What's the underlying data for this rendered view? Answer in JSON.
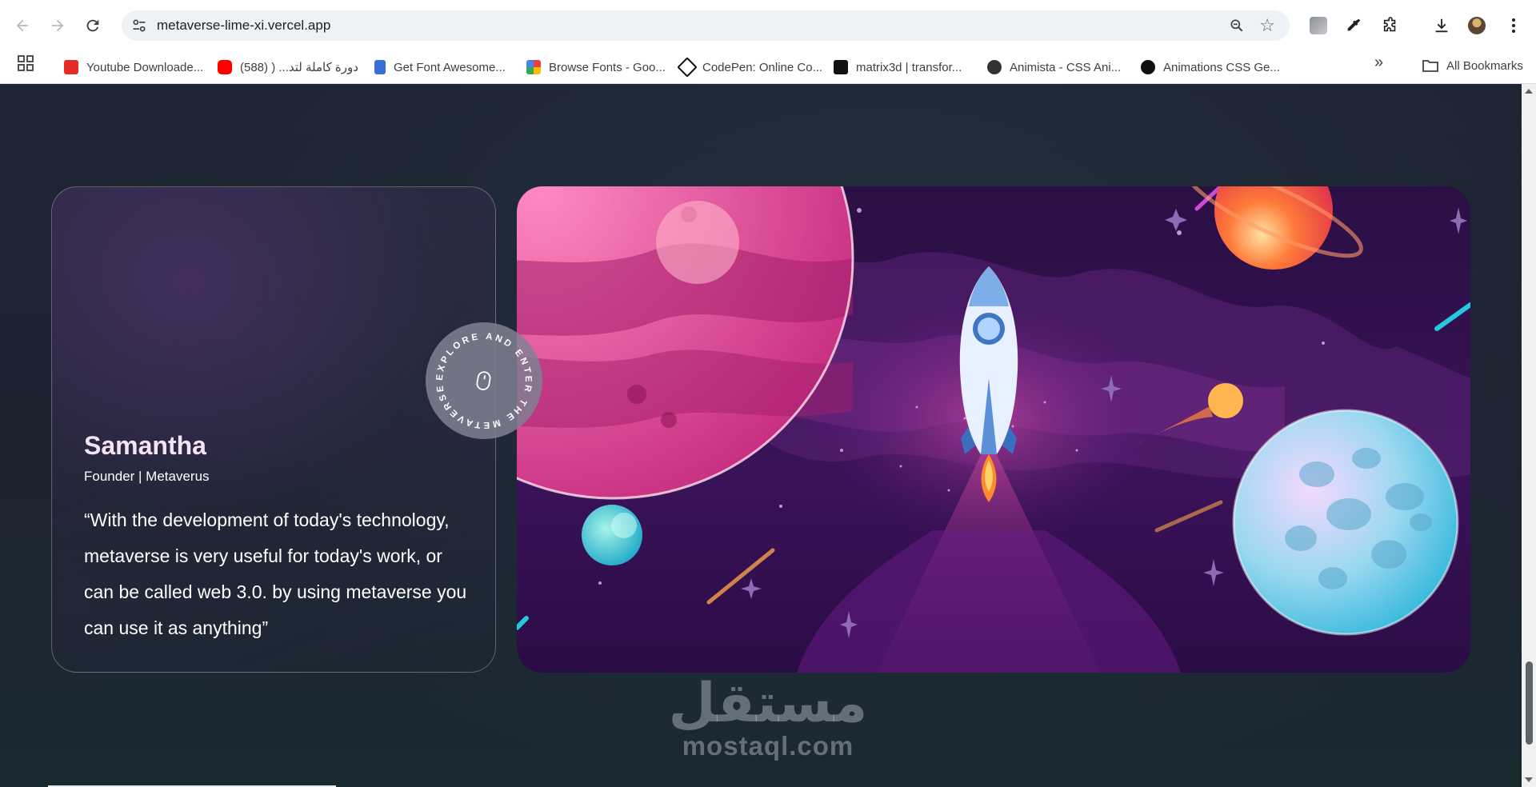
{
  "browser": {
    "url": "metaverse-lime-xi.vercel.app",
    "bookmarks": [
      {
        "label": "Youtube Downloade...",
        "color": "#e52d27"
      },
      {
        "label": "دورة كاملة لتد... ( (588)",
        "color": "#ff0000"
      },
      {
        "label": "Get Font Awesome...",
        "color": "#3b6dd8"
      },
      {
        "label": "Browse Fonts - Goo...",
        "color": "#34a853"
      },
      {
        "label": "CodePen: Online Co...",
        "color": "#111111"
      },
      {
        "label": "matrix3d | transfor...",
        "color": "#111111"
      },
      {
        "label": "Animista - CSS Ani...",
        "color": "#333333"
      },
      {
        "label": "Animations CSS Ge...",
        "color": "#111111"
      }
    ],
    "all_bookmarks_label": "All Bookmarks"
  },
  "testimonial": {
    "name": "Samantha",
    "role": "Founder | Metaverus",
    "quote": "“With the development of today's technology, metaverse is very useful for today's work, or can be called web 3.0. by using metaverse you can use it as anything”"
  },
  "badge": {
    "text": "EXPLORE AND ENTER THE METAVERSE"
  },
  "watermark": {
    "arabic": "مستقل",
    "latin": "mostaql.com"
  },
  "colors": {
    "accent": "#f3e4f5",
    "page_bg": "#1f2530"
  }
}
